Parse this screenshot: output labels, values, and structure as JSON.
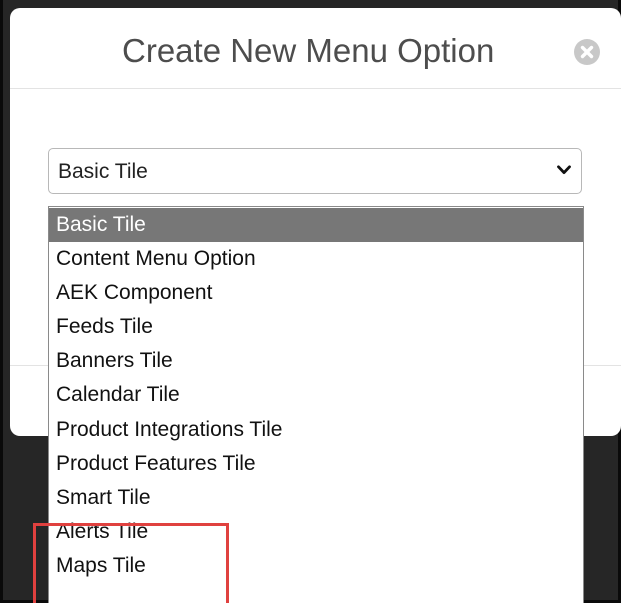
{
  "modal": {
    "title": "Create New Menu Option",
    "close_icon": "close-circle-icon"
  },
  "select": {
    "value": "Basic Tile",
    "chevron_icon": "chevron-down-icon"
  },
  "options": [
    {
      "label": "Basic Tile",
      "selected": true
    },
    {
      "label": "Content Menu Option",
      "selected": false
    },
    {
      "label": "AEK Component",
      "selected": false
    },
    {
      "label": "Feeds Tile",
      "selected": false
    },
    {
      "label": "Banners Tile",
      "selected": false
    },
    {
      "label": "Calendar Tile",
      "selected": false
    },
    {
      "label": "Product Integrations Tile",
      "selected": false
    },
    {
      "label": "Product Features Tile",
      "selected": false
    },
    {
      "label": "Smart Tile",
      "selected": false
    },
    {
      "label": "Alerts Tile",
      "selected": false
    },
    {
      "label": "Maps Tile",
      "selected": false
    }
  ],
  "annotation": {
    "color": "#e0413f",
    "highlighted_options": [
      "Alerts Tile",
      "Maps Tile"
    ]
  },
  "colors": {
    "selected_option_bg": "#777777",
    "overlay_bg": "#262626"
  }
}
